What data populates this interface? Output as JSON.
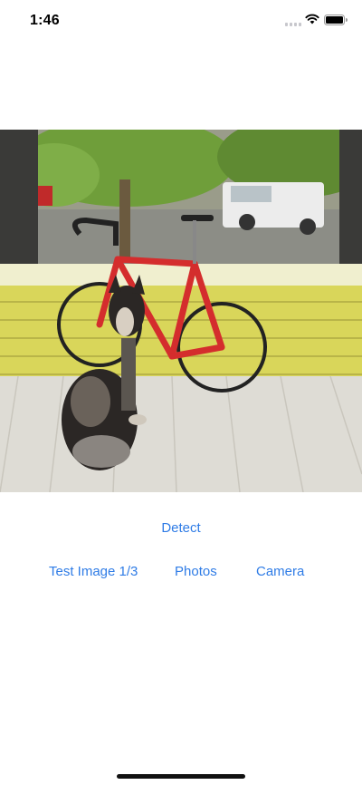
{
  "status_bar": {
    "time": "1:46",
    "icons": [
      "cellular-signal-icon",
      "wifi-icon",
      "battery-icon"
    ]
  },
  "photo": {
    "subject": "dog-and-bicycle-photo"
  },
  "actions": {
    "detect_label": "Detect",
    "test_image_label": "Test Image 1/3",
    "photos_label": "Photos",
    "camera_label": "Camera"
  },
  "colors": {
    "accent": "#2f7ce6",
    "background": "#ffffff"
  }
}
